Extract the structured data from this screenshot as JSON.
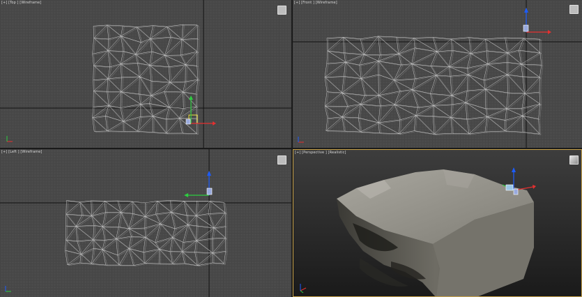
{
  "viewports": {
    "top": {
      "label": "[+] [Top ] [Wireframe]"
    },
    "front": {
      "label": "[+] [Front ] [Wireframe]"
    },
    "left": {
      "label": "[+] [Left ] [Wireframe]"
    },
    "perspective": {
      "label": "[+] [Perspective ] [Realistic]"
    }
  },
  "colors": {
    "wire": "#e6e6e6",
    "axis_x": "#e53030",
    "axis_y": "#2ecc40",
    "axis_z": "#1c5cff",
    "gizmo": "#f2e640",
    "active_border": "#c9a34a",
    "rock_top": "#8e8d85",
    "rock_side": "#5e5c55"
  },
  "icons": {
    "viewcube": "viewcube-icon",
    "transform_gizmo": "move-gizmo-icon",
    "world_axis": "world-axis-icon"
  }
}
